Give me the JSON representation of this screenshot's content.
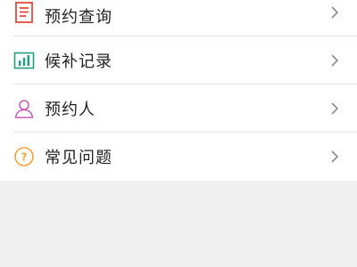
{
  "menu": {
    "items": [
      {
        "label": "预约查询",
        "icon": "document-list-icon"
      },
      {
        "label": "候补记录",
        "icon": "bar-chart-icon"
      },
      {
        "label": "预约人",
        "icon": "person-icon"
      },
      {
        "label": "常见问题",
        "icon": "question-circle-icon"
      }
    ]
  },
  "colors": {
    "doc_icon": "#e24a3b",
    "chart_icon": "#1e9d7f",
    "person_icon": "#c65fb6",
    "question_icon": "#f2a43a",
    "chevron": "#8c8c8c"
  }
}
